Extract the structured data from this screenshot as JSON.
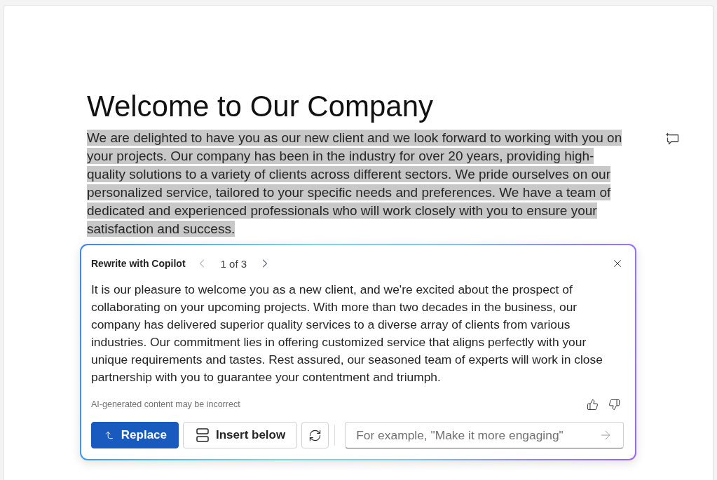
{
  "document": {
    "heading": "Welcome to Our Company",
    "paragraph": "We are delighted to have you as our new client and we look forward to working with you on your projects. Our company has been in the industry for over 20 years, providing high-quality solutions to a variety of clients across different sectors. We pride ourselves on our personalized service, tailored to your specific needs and preferences. We have a team of dedicated and experienced professionals who will work closely with you to ensure your satisfaction and success.",
    "selected": true
  },
  "copilot_panel": {
    "title": "Rewrite with Copilot",
    "pager": {
      "label": "1 of 3",
      "previous": {
        "disabled": true
      },
      "next": {
        "disabled": false
      }
    },
    "suggestion": "It is our pleasure to welcome you as a new client, and we're excited about the prospect of collaborating on your upcoming projects. With more than two decades in the business, our company has delivered superior quality services to a diverse array of clients from various industries. Our commitment lies in offering customized service that aligns perfectly with your unique requirements and tastes. Rest assured, our seasoned team of experts will work in close partnership with you to guarantee your contentment and triumph.",
    "disclaimer": "AI-generated content may be incorrect",
    "actions": [
      {
        "kind": "primary",
        "label": "Replace"
      },
      {
        "kind": "secondary",
        "label": "Insert below"
      }
    ],
    "prompt": {
      "placeholder": "For example, \"Make it more engaging\""
    }
  }
}
